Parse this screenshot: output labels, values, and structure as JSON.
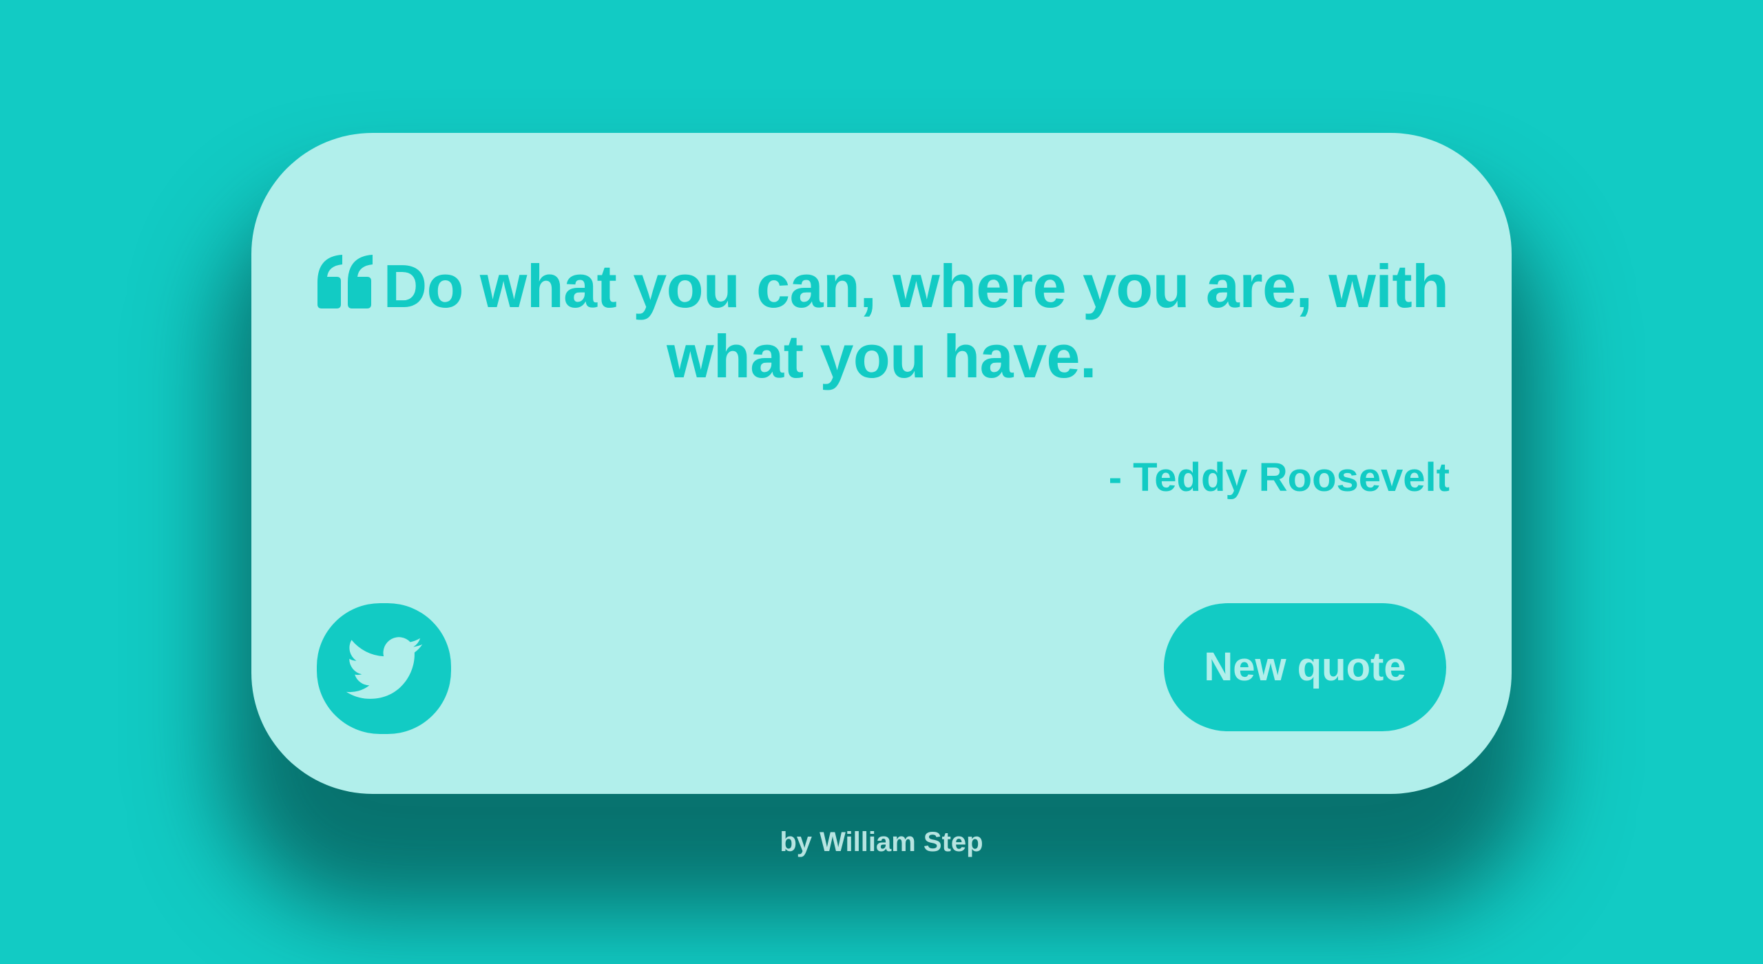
{
  "quote": {
    "text": "Do what you can, where you are, with what you have.",
    "author": "- Teddy Roosevelt",
    "icon": "quote-left-icon"
  },
  "buttons": {
    "tweet_icon": "twitter-icon",
    "new_quote_label": "New quote"
  },
  "footer": {
    "credit": "by William Step"
  },
  "colors": {
    "background": "#12cbc4",
    "card": "#b1efeb",
    "accent": "#12cbc4",
    "footer_text": "#b7e4e1"
  }
}
